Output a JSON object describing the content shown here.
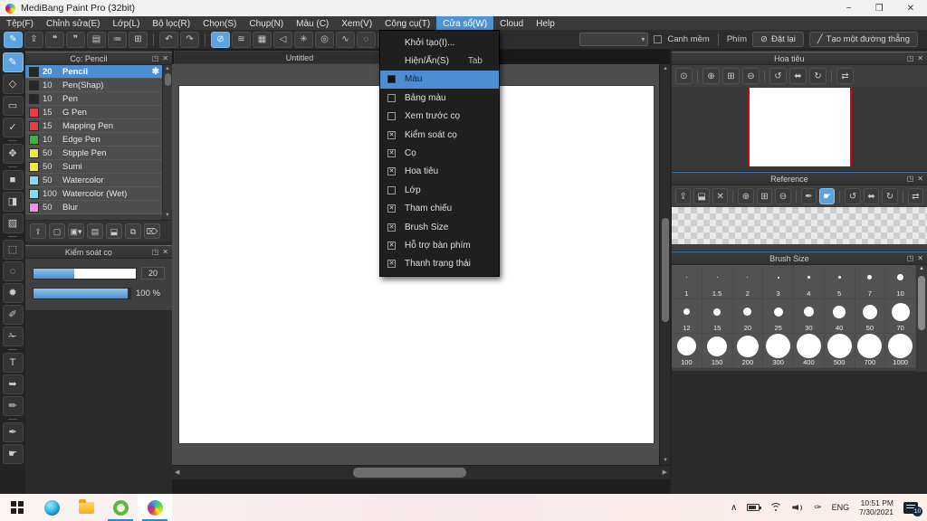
{
  "titlebar": {
    "title": "MediBang Paint Pro (32bit)"
  },
  "window_controls": {
    "minimize": "−",
    "restore": "❒",
    "close": "✕"
  },
  "menubar": {
    "items": [
      {
        "label": "Tệp(F)"
      },
      {
        "label": "Chỉnh sửa(E)"
      },
      {
        "label": "Lớp(L)"
      },
      {
        "label": "Bộ lọc(R)"
      },
      {
        "label": "Chọn(S)"
      },
      {
        "label": "Chụp(N)"
      },
      {
        "label": "Màu (C)"
      },
      {
        "label": "Xem(V)"
      },
      {
        "label": "Công cụ(T)"
      },
      {
        "label": "Cửa sổ(W)",
        "active": true
      },
      {
        "label": "Cloud"
      },
      {
        "label": "Help"
      }
    ]
  },
  "toolbar": {
    "groups": [
      {
        "name": "file-group",
        "buttons": [
          {
            "name": "paint-mode-button",
            "glyph": "✎",
            "selected": true
          },
          {
            "name": "publish-button",
            "glyph": "⇪"
          },
          {
            "name": "chat-button",
            "glyph": "❝"
          },
          {
            "name": "comment-button",
            "glyph": "❞"
          },
          {
            "name": "document-button",
            "glyph": "▤"
          },
          {
            "name": "checklist-button",
            "glyph": "≔"
          },
          {
            "name": "layout-edit-button",
            "glyph": "⊞"
          }
        ]
      },
      {
        "name": "history-group",
        "buttons": [
          {
            "name": "undo-button",
            "glyph": "↶"
          },
          {
            "name": "redo-button",
            "glyph": "↷"
          }
        ]
      },
      {
        "name": "snap-group",
        "buttons": [
          {
            "name": "snap-off-button",
            "glyph": "⊘",
            "selected": true
          },
          {
            "name": "parallel-snap-button",
            "glyph": "≋"
          },
          {
            "name": "grid-snap-button",
            "glyph": "▦"
          },
          {
            "name": "vanishing-point-snap-button",
            "glyph": "◁"
          },
          {
            "name": "radial-snap-button",
            "glyph": "✳"
          },
          {
            "name": "concentric-snap-button",
            "glyph": "◎"
          },
          {
            "name": "curve-snap-button",
            "glyph": "∿"
          },
          {
            "name": "ellipse-snap-button",
            "glyph": "◌"
          },
          {
            "name": "snap-settings-button",
            "glyph": "⚙"
          }
        ]
      },
      {
        "name": "close-group",
        "buttons": [
          {
            "name": "close-snap-button",
            "glyph": "⊠"
          }
        ]
      }
    ],
    "soft_edge_label": "Canh mềm",
    "key_label": "Phím",
    "reset_button": "Đặt lại",
    "reset_icon": "⊘",
    "line_button": "Tạo một đường thẳng",
    "line_icon": "╱"
  },
  "tools": [
    {
      "name": "brush-tool",
      "glyph": "✎",
      "selected": true
    },
    {
      "name": "eraser-tool",
      "glyph": "◇"
    },
    {
      "name": "shape-brush-tool",
      "glyph": "▭"
    },
    {
      "name": "polyline-tool",
      "glyph": "✓"
    },
    {
      "name": "move-tool",
      "glyph": "✥"
    },
    {
      "name": "fill-rect-tool",
      "glyph": "■"
    },
    {
      "name": "bucket-tool",
      "glyph": "◨"
    },
    {
      "name": "gradient-tool",
      "glyph": "▨"
    },
    {
      "name": "select-rect-tool",
      "glyph": "⬚"
    },
    {
      "name": "lasso-tool",
      "glyph": "◌"
    },
    {
      "name": "magic-wand-tool",
      "glyph": "✹"
    },
    {
      "name": "select-pen-tool",
      "glyph": "✐"
    },
    {
      "name": "select-eraser-tool",
      "glyph": "✁"
    },
    {
      "name": "text-tool",
      "glyph": "T"
    },
    {
      "name": "operation-tool",
      "glyph": "➥"
    },
    {
      "name": "pen-tool",
      "glyph": "✏"
    },
    {
      "name": "eyedropper-tool",
      "glyph": "✒"
    },
    {
      "name": "hand-tool",
      "glyph": "☛"
    }
  ],
  "brush_panel": {
    "title": "Cọ: Pencil",
    "brushes": [
      {
        "size": "20",
        "name": "Pencil",
        "color": "#262626",
        "selected": true
      },
      {
        "size": "10",
        "name": "Pen(Shap)",
        "color": "#262626"
      },
      {
        "size": "10",
        "name": "Pen",
        "color": "#262626"
      },
      {
        "size": "15",
        "name": "G Pen",
        "color": "#ed3b43"
      },
      {
        "size": "15",
        "name": "Mapping Pen",
        "color": "#ed3b43"
      },
      {
        "size": "10",
        "name": "Edge Pen",
        "color": "#3cb043"
      },
      {
        "size": "50",
        "name": "Stipple Pen",
        "color": "#f2e641"
      },
      {
        "size": "50",
        "name": "Sumi",
        "color": "#f2e641"
      },
      {
        "size": "50",
        "name": "Watercolor",
        "color": "#86dcf0"
      },
      {
        "size": "100",
        "name": "Watercolor (Wet)",
        "color": "#86dcf0"
      },
      {
        "size": "50",
        "name": "Blur",
        "color": "#f291e4"
      }
    ],
    "footer": [
      {
        "name": "cloud-upload-button",
        "glyph": "⇪"
      },
      {
        "name": "new-brush-button",
        "glyph": "▢"
      },
      {
        "name": "new-brush-menu-button",
        "glyph": "▣▾"
      },
      {
        "name": "script-brush-button",
        "glyph": "▤"
      },
      {
        "name": "brush-folder-button",
        "glyph": "⬓"
      },
      {
        "name": "duplicate-brush-button",
        "glyph": "⧉"
      },
      {
        "name": "delete-brush-button",
        "glyph": "⌦"
      }
    ]
  },
  "brush_control": {
    "title": "Kiểm soát cọ",
    "sliders": [
      {
        "name": "brush-size",
        "value": "20",
        "percent": 40
      },
      {
        "name": "brush-opacity",
        "value": "100 %",
        "percent": 97
      }
    ]
  },
  "canvas": {
    "tab": "Untitled"
  },
  "window_menu": {
    "items": [
      {
        "label": "Khởi tạo(I)..."
      },
      {
        "label": "Hiện/Ẩn(S)",
        "shortcut": "Tab"
      },
      {
        "label": "Màu",
        "check": "solid",
        "active": true
      },
      {
        "label": "Bảng màu",
        "check": "empty"
      },
      {
        "label": "Xem trước cọ",
        "check": "empty"
      },
      {
        "label": "Kiểm soát cọ",
        "check": "x"
      },
      {
        "label": "Cọ",
        "check": "x"
      },
      {
        "label": "Hoa tiêu",
        "check": "x"
      },
      {
        "label": "Lớp",
        "check": "empty"
      },
      {
        "label": "Tham chiếu",
        "check": "x"
      },
      {
        "label": "Brush Size",
        "check": "x"
      },
      {
        "label": "Hỗ trợ bàn phím",
        "check": "x"
      },
      {
        "label": "Thanh trạng thái",
        "check": "x"
      }
    ]
  },
  "navigator": {
    "title": "Hoa tiêu",
    "view_border_color": "#cf0a0a",
    "toolbar": [
      {
        "name": "zoom-actual-button",
        "glyph": "⊙"
      },
      {
        "sep": true
      },
      {
        "name": "zoom-in-button",
        "glyph": "⊕"
      },
      {
        "name": "fit-view-button",
        "glyph": "⊞"
      },
      {
        "name": "zoom-out-button",
        "glyph": "⊖"
      },
      {
        "sep": true
      },
      {
        "name": "rotate-ccw-button",
        "glyph": "↺"
      },
      {
        "name": "reset-rotation-button",
        "glyph": "⬌"
      },
      {
        "name": "rotate-cw-button",
        "glyph": "↻"
      },
      {
        "sep": true
      },
      {
        "name": "flip-view-button",
        "glyph": "⇄"
      }
    ]
  },
  "reference": {
    "title": "Reference",
    "toolbar": [
      {
        "name": "ref-cloud-open-button",
        "glyph": "⇪"
      },
      {
        "name": "ref-folder-open-button",
        "glyph": "⬓"
      },
      {
        "name": "ref-clear-button",
        "glyph": "✕"
      },
      {
        "sep": true
      },
      {
        "name": "ref-zoom-in-button",
        "glyph": "⊕"
      },
      {
        "name": "ref-fit-button",
        "glyph": "⊞"
      },
      {
        "name": "ref-zoom-out-button",
        "glyph": "⊖"
      },
      {
        "sep": true
      },
      {
        "name": "ref-eyedropper-button",
        "glyph": "✒"
      },
      {
        "name": "ref-hand-button",
        "glyph": "☛",
        "selected": true
      },
      {
        "sep": true
      },
      {
        "name": "ref-rotate-ccw-button",
        "glyph": "↺"
      },
      {
        "name": "ref-reset-rotation-button",
        "glyph": "⬌"
      },
      {
        "name": "ref-rotate-cw-button",
        "glyph": "↻"
      },
      {
        "sep": true
      },
      {
        "name": "ref-flip-button",
        "glyph": "⇄"
      }
    ]
  },
  "brush_size": {
    "title": "Brush Size",
    "rows": [
      [
        1,
        1.5,
        2,
        3,
        4,
        5,
        7,
        10
      ],
      [
        12,
        15,
        20,
        25,
        30,
        40,
        50,
        70
      ],
      [
        100,
        150,
        200,
        300,
        400,
        500,
        700,
        1000
      ]
    ]
  },
  "panel_icons": {
    "popout": "◳",
    "close": "✕"
  },
  "accent_color": "#4f94d4",
  "taskbar": {
    "language": "ENG",
    "time": "10:51 PM",
    "date": "7/30/2021",
    "notification_badge": "10"
  }
}
